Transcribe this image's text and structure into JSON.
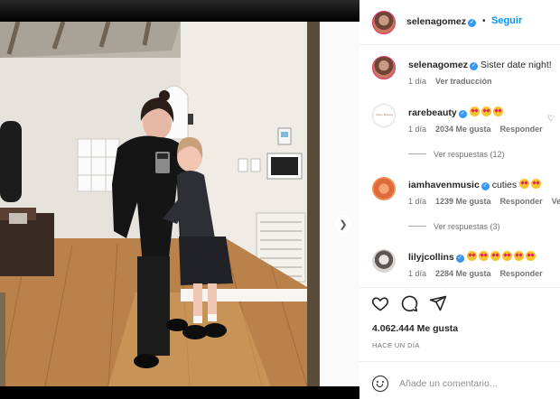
{
  "post": {
    "author": "selenagomez",
    "follow_label": "Seguir",
    "separator": "•",
    "caption_user": "selenagomez",
    "caption_text": "Sister date night!",
    "caption_time": "1 día",
    "see_translation": "Ver traducción",
    "likes": "4.062.444 Me gusta",
    "posted_ago": "HACE UN DÍA",
    "comment_placeholder": "Añade un comentario...",
    "carousel_count": 3,
    "carousel_active": 0
  },
  "avatars": {
    "rarebeauty_logo": "Rare Beauty"
  },
  "comments": [
    {
      "user": "rarebeauty",
      "verified": true,
      "text": "",
      "emojis": [
        "star-struck",
        "star-struck",
        "star-struck"
      ],
      "time": "1 día",
      "likes": "2034 Me gusta",
      "reply": "Responder",
      "view_replies": "Ver respuestas (12)"
    },
    {
      "user": "iamhavenmusic",
      "verified": true,
      "text": "cuties",
      "emojis": [
        "smiling-face-with-hearts",
        "smiling-face-with-hearts"
      ],
      "time": "1 día",
      "likes": "1239 Me gusta",
      "reply": "Responder",
      "extra": "Ve",
      "view_replies": "Ver respuestas (3)"
    },
    {
      "user": "lilyjcollins",
      "verified": true,
      "text": "",
      "emojis": [
        "star-struck",
        "star-struck",
        "star-struck",
        "star-struck",
        "star-struck",
        "star-struck"
      ],
      "time": "1 día",
      "likes": "2284 Me gusta",
      "reply": "Responder"
    }
  ],
  "icons": {
    "like": "heart-icon",
    "comment": "comment-icon",
    "share": "send-icon",
    "save": "bookmark-icon",
    "emoji": "emoji-icon",
    "next": "chevron-right-icon",
    "verified": "verified-badge-icon"
  },
  "colors": {
    "follow": "#0095f6",
    "verified": "#3897f0",
    "text": "#262626",
    "muted": "#737373"
  }
}
